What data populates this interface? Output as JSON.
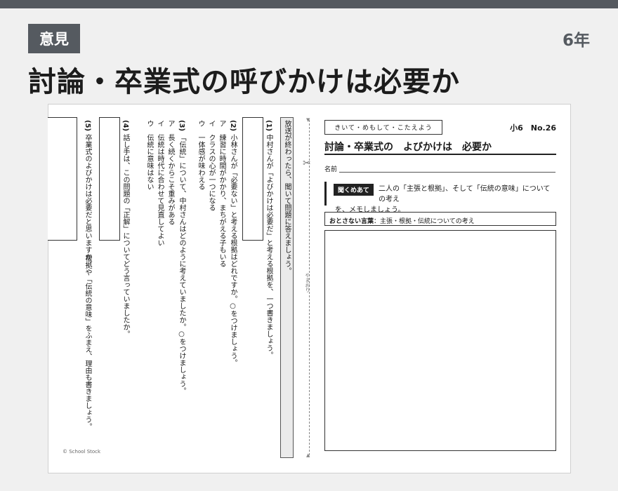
{
  "header": {
    "badge": "意見",
    "grade": "6年",
    "title": "討論・卒業式の呼びかけは必要か"
  },
  "worksheet": {
    "strip_label": "きいて・めもして・こたえよう",
    "issue": "小6　No.26",
    "title": "討論・卒業式の　よびかけは　必要か",
    "name_label": "名前",
    "prompt_tag": "聞くめあて",
    "prompt_line1": "二人の「主張と根拠」、そして「伝統の意味」についての考え",
    "prompt_line2": "を、メモしましょう。",
    "keywords_label": "おとさない言葉",
    "keywords_text": "：主張・根拠・伝統についての考え",
    "fold_label": "やまおり",
    "fold_icon": "scissors-icon",
    "copyright": "© School Stock"
  },
  "questions": {
    "intro": "放送が終わったら、聞いて問題に答えましょう。",
    "q1_num": "(1)",
    "q1_text": "中村さんが「よびかけは必要だ」と考える根拠を、一つ書きましょう。",
    "q2_num": "(2)",
    "q2_text": "小林さんが「必要ない」と考える根拠はどれですか。○をつけましょう。",
    "q2_opts": [
      "ア　練習に時間がかかり、まちがえる子もいる",
      "イ　クラスの心が一つになる",
      "ウ　一体感が味わえる"
    ],
    "q3_num": "(3)",
    "q3_text": "「伝統」について、中村さんはどのように考えていましたか。○をつけましょう。",
    "q3_opts": [
      "ア　長く続くからこそ重みがある",
      "イ　伝統は時代に合わせて見直してよい",
      "ウ　伝統に意味はない"
    ],
    "q4_num": "(4)",
    "q4_text": "話し手は、この問題の「正解」についてどう言っていましたか。",
    "q5_num": "(5)",
    "q5_line1": "卒業式のよびかけは必要だと思いますか。",
    "q5_line2": "根拠や「伝統の意味」をふまえ、理由も書きましょう。"
  }
}
